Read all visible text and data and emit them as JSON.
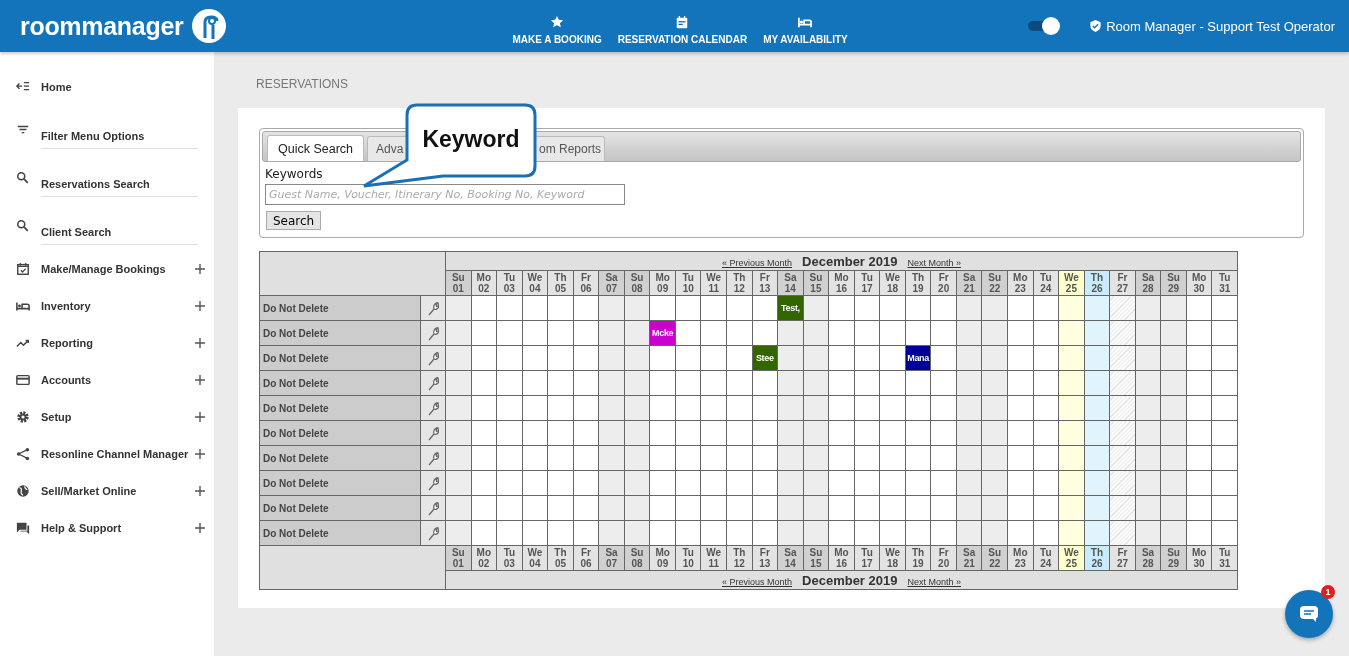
{
  "header": {
    "logo": "roommanager",
    "nav": [
      {
        "label": "MAKE A BOOKING"
      },
      {
        "label": "RESERVATION CALENDAR"
      },
      {
        "label": "MY AVAILABILITY"
      }
    ],
    "toggle": {
      "on": true
    },
    "user": "Room Manager - Support Test Operator"
  },
  "sidebar": {
    "items": [
      {
        "kind": "link",
        "label": "Home"
      },
      {
        "kind": "field",
        "label": "Filter Menu Options"
      },
      {
        "kind": "field",
        "label": "Reservations Search"
      },
      {
        "kind": "field",
        "label": "Client Search"
      },
      {
        "kind": "group",
        "label": "Make/Manage Bookings",
        "expanded": false
      },
      {
        "kind": "group",
        "label": "Inventory",
        "expanded": false
      },
      {
        "kind": "group",
        "label": "Reporting",
        "expanded": false
      },
      {
        "kind": "group",
        "label": "Accounts",
        "expanded": false
      },
      {
        "kind": "group",
        "label": "Setup",
        "expanded": false
      },
      {
        "kind": "group",
        "label": "Resonline Channel Manager",
        "expanded": false
      },
      {
        "kind": "group",
        "label": "Sell/Market Online",
        "expanded": false
      },
      {
        "kind": "group",
        "label": "Help & Support",
        "expanded": false
      }
    ]
  },
  "page_title": "RESERVATIONS",
  "search": {
    "tabs": [
      {
        "label": "Quick Search",
        "selected": true
      },
      {
        "label": "Adva",
        "selected": false
      },
      {
        "label": "om Reports",
        "selected": false
      }
    ],
    "field_label": "Keywords",
    "placeholder": "Guest Name, Voucher, Itinerary No, Booking No, Keyword",
    "button": "Search"
  },
  "callout": "Keyword",
  "calendar": {
    "top_nav": {
      "previous": "« Previous Month",
      "month": "December 2019",
      "next": "Next Month »"
    },
    "header_days": [
      {
        "name": "Su",
        "date": "01",
        "kind": "weekend"
      },
      {
        "name": "Mo",
        "date": "02",
        "kind": "weekday"
      },
      {
        "name": "Tu",
        "date": "03",
        "kind": "weekday"
      },
      {
        "name": "We",
        "date": "04",
        "kind": "weekday"
      },
      {
        "name": "Th",
        "date": "05",
        "kind": "weekday"
      },
      {
        "name": "Fr",
        "date": "06",
        "kind": "weekday"
      },
      {
        "name": "Sa",
        "date": "07",
        "kind": "weekend"
      },
      {
        "name": "Su",
        "date": "08",
        "kind": "weekend"
      },
      {
        "name": "Mo",
        "date": "09",
        "kind": "weekday"
      },
      {
        "name": "Tu",
        "date": "10",
        "kind": "weekday"
      },
      {
        "name": "We",
        "date": "11",
        "kind": "weekday"
      },
      {
        "name": "Th",
        "date": "12",
        "kind": "weekday"
      },
      {
        "name": "Fr",
        "date": "13",
        "kind": "weekday"
      },
      {
        "name": "Sa",
        "date": "14",
        "kind": "weekend"
      },
      {
        "name": "Su",
        "date": "15",
        "kind": "weekend"
      },
      {
        "name": "Mo",
        "date": "16",
        "kind": "weekday"
      },
      {
        "name": "Tu",
        "date": "17",
        "kind": "weekday"
      },
      {
        "name": "We",
        "date": "18",
        "kind": "weekday"
      },
      {
        "name": "Th",
        "date": "19",
        "kind": "weekday"
      },
      {
        "name": "Fr",
        "date": "20",
        "kind": "weekday"
      },
      {
        "name": "Sa",
        "date": "21",
        "kind": "weekend"
      },
      {
        "name": "Su",
        "date": "22",
        "kind": "weekend"
      },
      {
        "name": "Mo",
        "date": "23",
        "kind": "weekday"
      },
      {
        "name": "Tu",
        "date": "24",
        "kind": "weekday"
      },
      {
        "name": "We",
        "date": "25",
        "kind": "holiday"
      },
      {
        "name": "Th",
        "date": "26",
        "kind": "today"
      },
      {
        "name": "Fr",
        "date": "27",
        "kind": "closed"
      },
      {
        "name": "Sa",
        "date": "28",
        "kind": "weekend"
      },
      {
        "name": "Su",
        "date": "29",
        "kind": "weekend"
      },
      {
        "name": "Mo",
        "date": "30",
        "kind": "weekday"
      },
      {
        "name": "Tu",
        "date": "31",
        "kind": "weekday"
      }
    ],
    "rows": [
      {
        "name": "Do Not Delete",
        "cells": [
          null,
          null,
          null,
          null,
          null,
          null,
          null,
          null,
          null,
          null,
          null,
          null,
          null,
          {
            "label": "Test,",
            "color": "#336600"
          },
          null,
          null,
          null,
          null,
          null,
          null,
          null,
          null,
          null,
          null,
          null,
          null,
          null,
          null,
          null,
          null,
          null
        ]
      },
      {
        "name": "Do Not Delete",
        "cells": [
          null,
          null,
          null,
          null,
          null,
          null,
          null,
          null,
          {
            "label": "Mcke",
            "color": "#cc00cc"
          },
          null,
          null,
          null,
          null,
          null,
          null,
          null,
          null,
          null,
          null,
          null,
          null,
          null,
          null,
          null,
          null,
          null,
          null,
          null,
          null,
          null,
          null
        ]
      },
      {
        "name": "Do Not Delete",
        "cells": [
          null,
          null,
          null,
          null,
          null,
          null,
          null,
          null,
          null,
          null,
          null,
          null,
          {
            "label": "Stee",
            "color": "#336600"
          },
          null,
          null,
          null,
          null,
          null,
          {
            "label": "Mana",
            "color": "#000099"
          },
          null,
          null,
          null,
          null,
          null,
          null,
          null,
          null,
          null,
          null,
          null,
          null
        ]
      },
      {
        "name": "Do Not Delete",
        "cells": [
          null,
          null,
          null,
          null,
          null,
          null,
          null,
          null,
          null,
          null,
          null,
          null,
          null,
          null,
          null,
          null,
          null,
          null,
          null,
          null,
          null,
          null,
          null,
          null,
          null,
          null,
          null,
          null,
          null,
          null,
          null
        ]
      },
      {
        "name": "Do Not Delete",
        "cells": [
          null,
          null,
          null,
          null,
          null,
          null,
          null,
          null,
          null,
          null,
          null,
          null,
          null,
          null,
          null,
          null,
          null,
          null,
          null,
          null,
          null,
          null,
          null,
          null,
          null,
          null,
          null,
          null,
          null,
          null,
          null
        ]
      },
      {
        "name": "Do Not Delete",
        "cells": [
          null,
          null,
          null,
          null,
          null,
          null,
          null,
          null,
          null,
          null,
          null,
          null,
          null,
          null,
          null,
          null,
          null,
          null,
          null,
          null,
          null,
          null,
          null,
          null,
          null,
          null,
          null,
          null,
          null,
          null,
          null
        ]
      },
      {
        "name": "Do Not Delete",
        "cells": [
          null,
          null,
          null,
          null,
          null,
          null,
          null,
          null,
          null,
          null,
          null,
          null,
          null,
          null,
          null,
          null,
          null,
          null,
          null,
          null,
          null,
          null,
          null,
          null,
          null,
          null,
          null,
          null,
          null,
          null,
          null
        ]
      },
      {
        "name": "Do Not Delete",
        "cells": [
          null,
          null,
          null,
          null,
          null,
          null,
          null,
          null,
          null,
          null,
          null,
          null,
          null,
          null,
          null,
          null,
          null,
          null,
          null,
          null,
          null,
          null,
          null,
          null,
          null,
          null,
          null,
          null,
          null,
          null,
          null
        ]
      },
      {
        "name": "Do Not Delete",
        "cells": [
          null,
          null,
          null,
          null,
          null,
          null,
          null,
          null,
          null,
          null,
          null,
          null,
          null,
          null,
          null,
          null,
          null,
          null,
          null,
          null,
          null,
          null,
          null,
          null,
          null,
          null,
          null,
          null,
          null,
          null,
          null
        ]
      },
      {
        "name": "Do Not Delete",
        "cells": [
          null,
          null,
          null,
          null,
          null,
          null,
          null,
          null,
          null,
          null,
          null,
          null,
          null,
          null,
          null,
          null,
          null,
          null,
          null,
          null,
          null,
          null,
          null,
          null,
          null,
          null,
          null,
          null,
          null,
          null,
          null
        ]
      }
    ],
    "footer_days": [
      {
        "name": "Su",
        "date": "01",
        "kind": "weekend"
      },
      {
        "name": "Mo",
        "date": "02",
        "kind": "weekday"
      },
      {
        "name": "Tu",
        "date": "03",
        "kind": "weekday"
      },
      {
        "name": "We",
        "date": "04",
        "kind": "weekday"
      },
      {
        "name": "Th",
        "date": "05",
        "kind": "weekday"
      },
      {
        "name": "Fr",
        "date": "06",
        "kind": "weekday"
      },
      {
        "name": "Sa",
        "date": "07",
        "kind": "weekend"
      },
      {
        "name": "Su",
        "date": "08",
        "kind": "weekend"
      },
      {
        "name": "Mo",
        "date": "09",
        "kind": "weekday"
      },
      {
        "name": "Tu",
        "date": "10",
        "kind": "weekday"
      },
      {
        "name": "We",
        "date": "11",
        "kind": "weekday"
      },
      {
        "name": "Th",
        "date": "12",
        "kind": "weekday"
      },
      {
        "name": "Fr",
        "date": "13",
        "kind": "weekday"
      },
      {
        "name": "Sa",
        "date": "14",
        "kind": "weekend"
      },
      {
        "name": "Su",
        "date": "15",
        "kind": "weekend"
      },
      {
        "name": "Mo",
        "date": "16",
        "kind": "weekday"
      },
      {
        "name": "Tu",
        "date": "17",
        "kind": "weekday"
      },
      {
        "name": "We",
        "date": "18",
        "kind": "weekday"
      },
      {
        "name": "Th",
        "date": "19",
        "kind": "weekday"
      },
      {
        "name": "Fr",
        "date": "20",
        "kind": "weekday"
      },
      {
        "name": "Sa",
        "date": "21",
        "kind": "weekend"
      },
      {
        "name": "Su",
        "date": "22",
        "kind": "weekend"
      },
      {
        "name": "Mo",
        "date": "23",
        "kind": "weekday"
      },
      {
        "name": "Tu",
        "date": "24",
        "kind": "weekday"
      },
      {
        "name": "We",
        "date": "25",
        "kind": "holiday"
      },
      {
        "name": "Th",
        "date": "26",
        "kind": "today"
      },
      {
        "name": "Fr",
        "date": "27",
        "kind": "closed"
      },
      {
        "name": "Sa",
        "date": "28",
        "kind": "weekend"
      },
      {
        "name": "Su",
        "date": "29",
        "kind": "weekend"
      },
      {
        "name": "Mo",
        "date": "30",
        "kind": "weekday"
      },
      {
        "name": "Tu",
        "date": "31",
        "kind": "weekday"
      }
    ],
    "bottom_nav": {
      "previous": "« Previous Month",
      "month": "December 2019",
      "next": "Next Month »"
    }
  },
  "chat": {
    "badge": "1"
  }
}
